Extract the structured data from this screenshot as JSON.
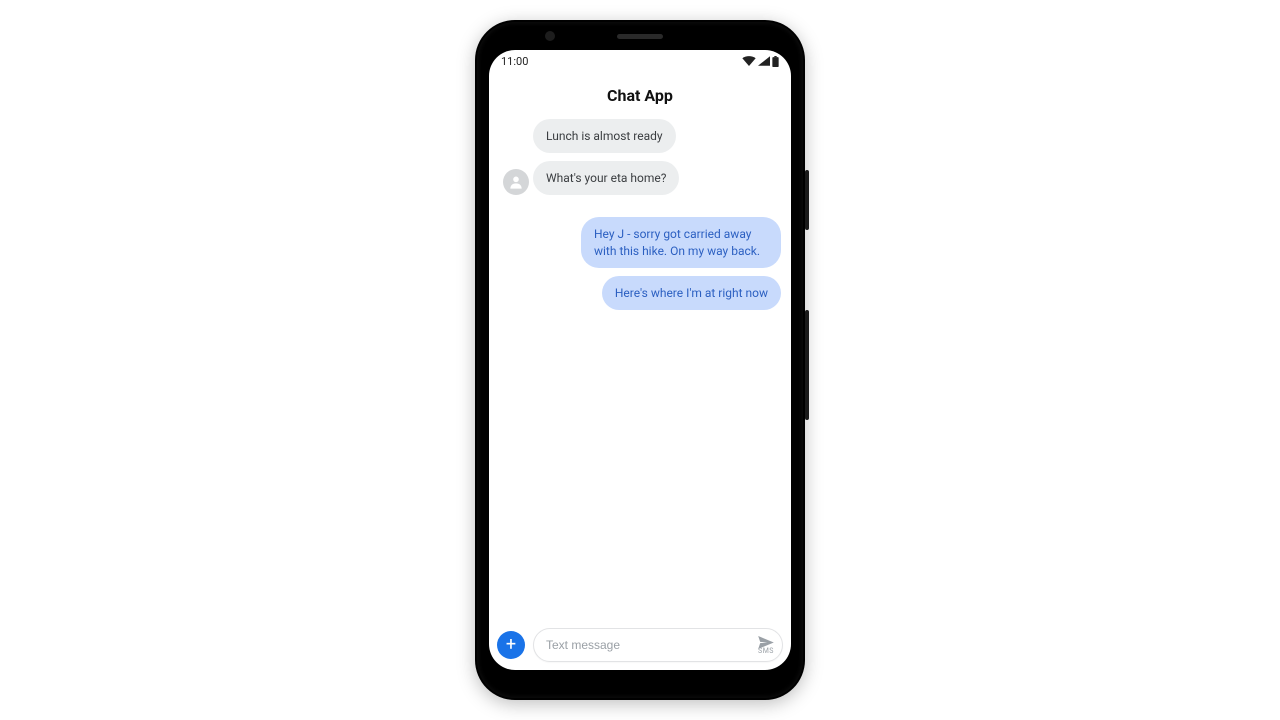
{
  "statusbar": {
    "time": "11:00"
  },
  "header": {
    "title": "Chat App"
  },
  "messages": {
    "incoming": [
      {
        "text": "Lunch is almost ready"
      },
      {
        "text": "What's your eta home?"
      }
    ],
    "outgoing": [
      {
        "text": "Hey J - sorry got carried away with this hike. On my way back."
      },
      {
        "text": "Here's where I'm at right now"
      }
    ]
  },
  "composer": {
    "placeholder": "Text message",
    "send_label": "SMS",
    "add_label": "+"
  }
}
